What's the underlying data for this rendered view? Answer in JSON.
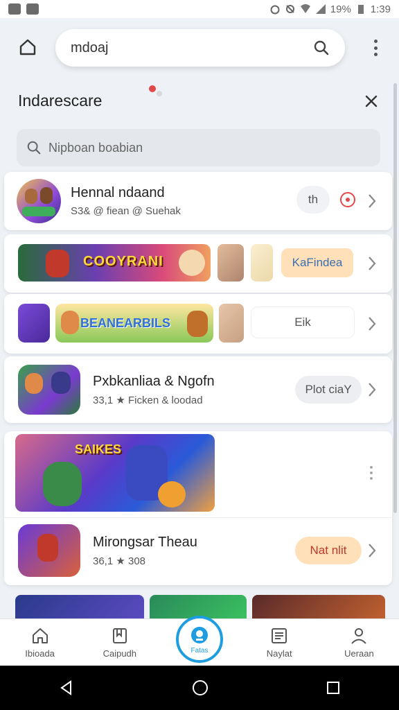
{
  "status_bar": {
    "battery": "19%",
    "time": "1:39"
  },
  "search": {
    "query": "mdoaj"
  },
  "panel": {
    "title": "Indarescare",
    "filter_placeholder": "Nipboan boabian"
  },
  "items": [
    {
      "title": "Hennal ndaand",
      "subtitle": "S3& @ fiean @ Suehak",
      "action_label": "th"
    },
    {
      "banner_text": "COOYRANI",
      "action_label": "KaFindea"
    },
    {
      "banner_text": "BEANEARBILS",
      "action_label": "Eik"
    },
    {
      "title": "Pxbkanliaa & Ngofn",
      "subtitle": "33,1 ★ Ficken & loodad",
      "action_label": "Plot ciaY"
    },
    {
      "banner_text": "SAIKES"
    },
    {
      "title": "Mirongsar Theau",
      "subtitle": "36,1 ★ 308",
      "action_label": "Nat nlit"
    }
  ],
  "bottom_nav": [
    {
      "label": "Ibioada",
      "icon": "home-icon"
    },
    {
      "label": "Caipudh",
      "icon": "bookmark-icon"
    },
    {
      "label": "Fatas",
      "icon": "center-icon"
    },
    {
      "label": "Naylat",
      "icon": "news-icon"
    },
    {
      "label": "Ueraan",
      "icon": "person-icon"
    }
  ],
  "colors": {
    "accent": "#1e9ee0",
    "pill_orange": "#ffe0b8",
    "pill_grey": "#eceef2",
    "red": "#e34848"
  }
}
